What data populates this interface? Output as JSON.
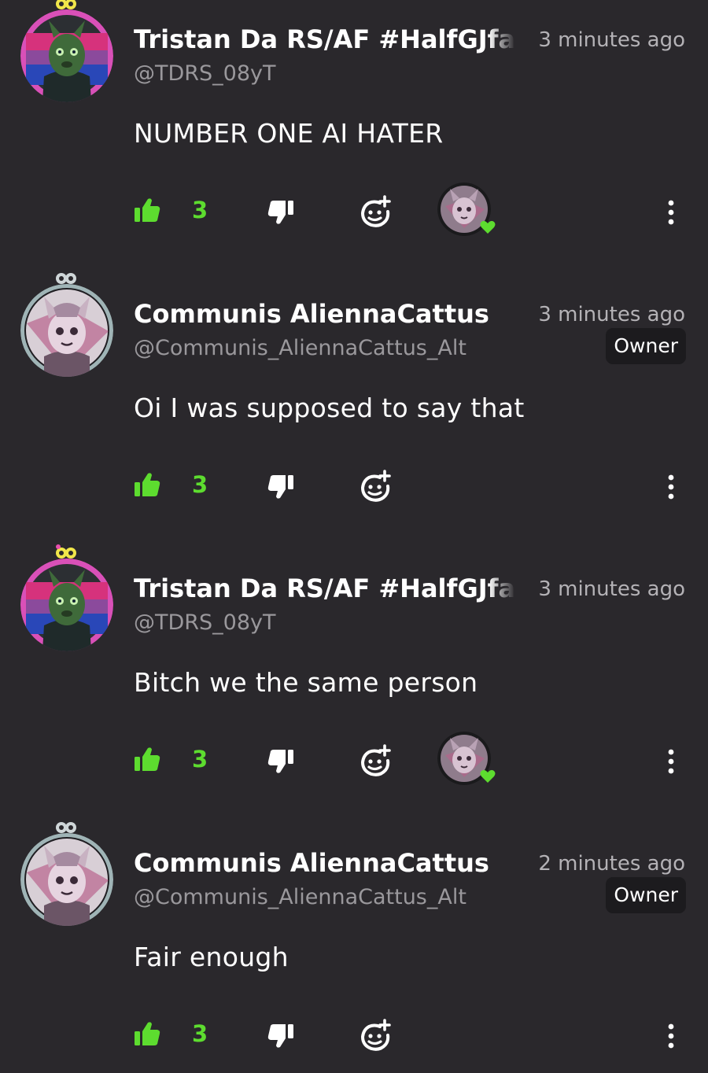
{
  "comments": [
    {
      "username": "Tristan Da RS/AF #HalfGJfam",
      "handle": "@TDRS_08yT",
      "timestamp": "3 minutes ago",
      "badge": "",
      "text": "NUMBER ONE AI HATER",
      "likes": "3",
      "avatar": "tristan",
      "has_reactor": true
    },
    {
      "username": "Communis AliennaCattus",
      "handle": "@Communis_AliennaCattus_Alt",
      "timestamp": "3 minutes ago",
      "badge": "Owner",
      "text": "Oi I was supposed to say that",
      "likes": "3",
      "avatar": "communis",
      "has_reactor": false
    },
    {
      "username": "Tristan Da RS/AF #HalfGJfam",
      "handle": "@TDRS_08yT",
      "timestamp": "3 minutes ago",
      "badge": "",
      "text": "Bitch we the same person",
      "likes": "3",
      "avatar": "tristan",
      "has_reactor": true
    },
    {
      "username": "Communis AliennaCattus",
      "handle": "@Communis_AliennaCattus_Alt",
      "timestamp": "2 minutes ago",
      "badge": "Owner",
      "text": "Fair enough",
      "likes": "3",
      "avatar": "communis",
      "has_reactor": false
    }
  ],
  "colors": {
    "background": "#2a282c",
    "like_green": "#5ddc2f",
    "owner_badge_bg": "#1c1b1e"
  },
  "icons": {
    "like": "thumbs-up-icon",
    "dislike": "thumbs-down-icon",
    "react": "add-reaction-icon",
    "more": "more-vertical-icon",
    "heart": "heart-icon"
  }
}
